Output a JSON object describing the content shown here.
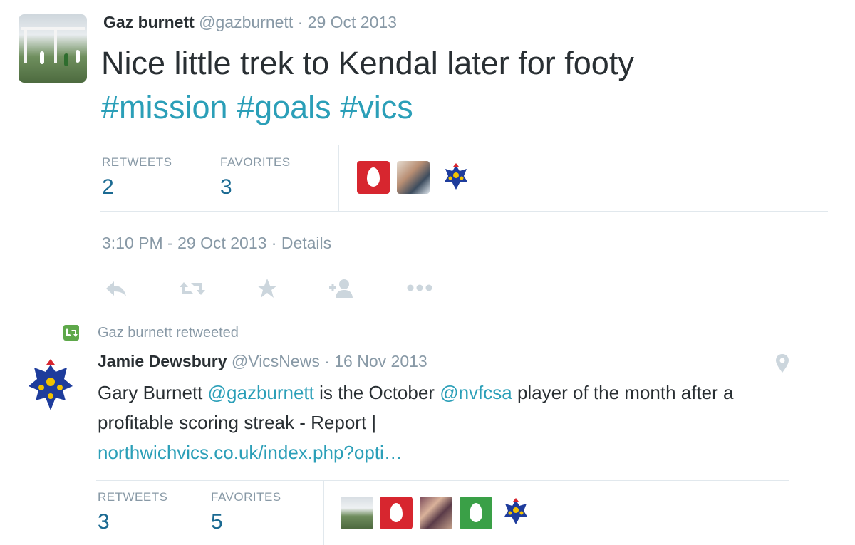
{
  "tweet1": {
    "author_name": "Gaz burnett",
    "author_handle": "@gazburnett",
    "date": "· 29 Oct 2013",
    "text": "Nice little trek to Kendal later for footy",
    "hashtags": [
      "#mission",
      "#goals",
      "#vics"
    ],
    "stats": {
      "retweets_label": "RETWEETS",
      "retweets_value": "2",
      "favorites_label": "FAVORITES",
      "favorites_value": "3"
    },
    "favoriters": [
      "red-egg-avatar",
      "man-photo-avatar",
      "crest-avatar"
    ],
    "timestamp": "3:10 PM - 29 Oct 2013",
    "details_label": "· Details",
    "actions": [
      "reply-icon",
      "retweet-icon",
      "favorite-icon",
      "follow-icon",
      "more-icon"
    ]
  },
  "retweet_context": {
    "label": "Gaz burnett retweeted",
    "icon": "retweet-badge-icon"
  },
  "tweet2": {
    "author_name": "Jamie Dewsbury",
    "author_handle": "@VicsNews",
    "date": "· 16 Nov 2013",
    "text_1": "Gary Burnett ",
    "mention_1": "@gazburnett",
    "text_2": " is the October ",
    "mention_2": "@nvfcsa",
    "text_3": " player of the month after a profitable scoring streak - Report | ",
    "link": "northwichvics.co.uk/index.php?opti…",
    "location_icon": "location-pin-icon",
    "stats": {
      "retweets_label": "RETWEETS",
      "retweets_value": "3",
      "favorites_label": "FAVORITES",
      "favorites_value": "5"
    },
    "favoriters": [
      "field-photo-avatar",
      "red-egg-avatar",
      "couple-photo-avatar",
      "green-egg-avatar",
      "crest-avatar"
    ]
  },
  "colors": {
    "link": "#2b9fb8",
    "stat_value": "#1b6a92",
    "muted": "#8899a6",
    "egg_red": "#d7262f",
    "egg_green": "#3aa047",
    "crest_blue": "#1e3c9c",
    "crest_yellow": "#f2c200"
  }
}
